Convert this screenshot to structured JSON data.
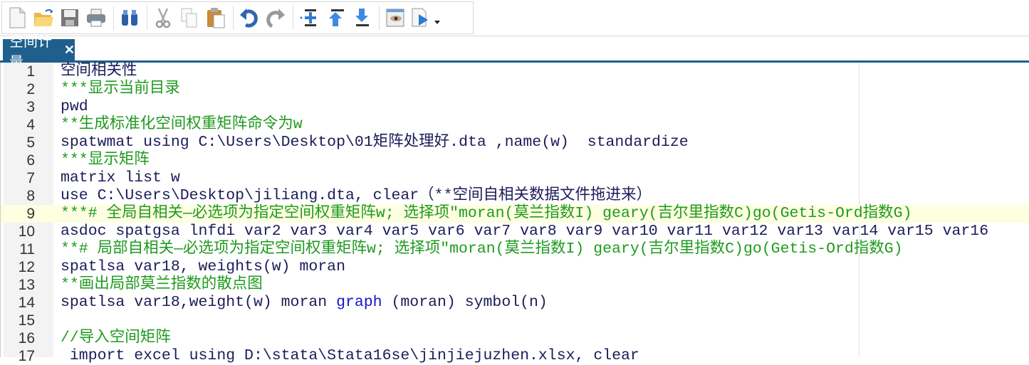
{
  "toolbar": {
    "buttons": [
      "new-file",
      "open",
      "save",
      "print",
      "find",
      "cut",
      "copy",
      "paste",
      "undo",
      "redo",
      "insert-line",
      "move-up",
      "move-down",
      "view",
      "execute"
    ]
  },
  "tab": {
    "label": "空间计量",
    "close": "✕"
  },
  "lines": [
    {
      "n": "1",
      "segs": [
        {
          "t": "空间相关性",
          "c": "c-plain"
        }
      ]
    },
    {
      "n": "2",
      "segs": [
        {
          "t": "***显示当前目录",
          "c": "c-comment"
        }
      ]
    },
    {
      "n": "3",
      "segs": [
        {
          "t": "pwd",
          "c": "c-kw"
        }
      ]
    },
    {
      "n": "4",
      "segs": [
        {
          "t": "**生成标准化空间权重矩阵命令为w",
          "c": "c-comment"
        }
      ]
    },
    {
      "n": "5",
      "segs": [
        {
          "t": "spatwmat using C:\\Users\\Desktop\\01矩阵处理好.dta ,name(w)  standardize",
          "c": "c-plain"
        }
      ]
    },
    {
      "n": "6",
      "segs": [
        {
          "t": "***显示矩阵",
          "c": "c-comment"
        }
      ]
    },
    {
      "n": "7",
      "segs": [
        {
          "t": "matrix list w",
          "c": "c-kw"
        }
      ]
    },
    {
      "n": "8",
      "segs": [
        {
          "t": "use C:\\Users\\Desktop\\jiliang.dta, clear（**空间自相关数据文件拖进来）",
          "c": "c-plain"
        }
      ]
    },
    {
      "n": "9",
      "hl": true,
      "segs": [
        {
          "t": "***# 全局自相关—必选项为指定空间权重矩阵w; 选择项\"moran(莫兰指数I) geary(吉尔里指数C)go(Getis-Ord指数G)",
          "c": "c-comment"
        }
      ]
    },
    {
      "n": "10",
      "segs": [
        {
          "t": "asdoc spatgsa lnfdi var2 var3 var4 var5 var6 var7 var8 var9 var10 var11 var12 var13 var14 var15 var16",
          "c": "c-plain"
        }
      ]
    },
    {
      "n": "11",
      "segs": [
        {
          "t": "**# 局部自相关—必选项为指定空间权重矩阵w; 选择项\"moran(莫兰指数I) geary(吉尔里指数C)go(Getis-Ord指数G)",
          "c": "c-comment"
        }
      ]
    },
    {
      "n": "12",
      "segs": [
        {
          "t": "spatlsa var18, weights(w) moran",
          "c": "c-plain"
        }
      ]
    },
    {
      "n": "13",
      "segs": [
        {
          "t": "**画出局部莫兰指数的散点图",
          "c": "c-comment"
        }
      ]
    },
    {
      "n": "14",
      "segs": [
        {
          "t": "spatlsa var18,weight(w) moran ",
          "c": "c-plain"
        },
        {
          "t": "graph",
          "c": "c-blue"
        },
        {
          "t": " (moran) symbol(n)",
          "c": "c-plain"
        }
      ]
    },
    {
      "n": "15",
      "segs": []
    },
    {
      "n": "16",
      "segs": [
        {
          "t": "//导入空间矩阵",
          "c": "c-comment"
        }
      ]
    },
    {
      "n": "17",
      "segs": [
        {
          "t": " import excel using D:\\stata\\Stata16se\\jinjiejuzhen.xlsx, clear",
          "c": "c-plain"
        }
      ]
    }
  ]
}
